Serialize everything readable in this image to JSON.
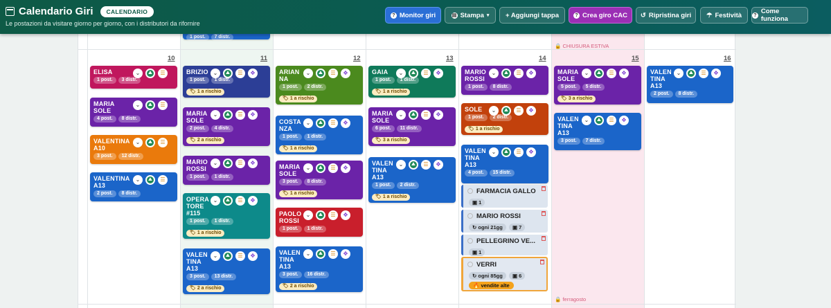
{
  "header": {
    "title": "Calendario Giri",
    "badge": "CALENDARIO",
    "subtitle": "Le postazioni da visitare giorno per giorno, con i distributori da rifornire",
    "buttons": {
      "monitor": "Monitor giri",
      "stampa": "Stampa",
      "aggiungi": "+ Aggiungi tappa",
      "crea_cac": "Crea giro CAC",
      "ripristina": "Ripristina giri",
      "festivita": "Festività",
      "come_funziona": "Come funziona"
    }
  },
  "prev_week": {
    "posts": "1 post.",
    "distr": "7 distr.",
    "closure": "CHIUSURA ESTIVA"
  },
  "days": [
    "10",
    "11",
    "12",
    "13",
    "14",
    "15",
    "16"
  ],
  "ferragosto": "ferragosto",
  "cols": [
    [
      {
        "name": "ELISA",
        "color": "#c0175d",
        "posts": "1 post.",
        "distr": "3 distr.",
        "risk": "",
        "move": false
      },
      {
        "name": "MARIA SOLE",
        "color": "#6b23a8",
        "posts": "4 post.",
        "distr": "8 distr.",
        "risk": "",
        "move": false
      },
      {
        "name": "VALENTINA A10",
        "color": "#ea7a0c",
        "posts": "3 post.",
        "distr": "12 distr.",
        "risk": "",
        "move": false
      },
      {
        "name": "VALENTINA A13",
        "color": "#1b65c9",
        "posts": "2 post.",
        "distr": "8 distr.",
        "risk": "",
        "move": false
      }
    ],
    [
      {
        "name": "BRIZIO",
        "color": "#2c3e96",
        "posts": "1 post.",
        "distr": "1 distr.",
        "risk": "1 a rischio",
        "move": true
      },
      {
        "name": "MARIA SOLE",
        "color": "#6b23a8",
        "posts": "2 post.",
        "distr": "4 distr.",
        "risk": "2 a rischio",
        "move": true
      },
      {
        "name": "MARIO ROSSI",
        "color": "#6b23a8",
        "posts": "1 post.",
        "distr": "1 distr.",
        "risk": "",
        "move": true
      },
      {
        "name": "OPERA TORE #115",
        "color": "#0d8a8a",
        "posts": "1 post.",
        "distr": "1 distr.",
        "risk": "1 a rischio",
        "move": true
      },
      {
        "name": "VALEN TINA A13",
        "color": "#1b65c9",
        "posts": "3 post.",
        "distr": "13 distr.",
        "risk": "2 a rischio",
        "move": true
      }
    ],
    [
      {
        "name": "ARIAN NA",
        "color": "#4b8a1e",
        "posts": "1 post.",
        "distr": "2 distr.",
        "risk": "1 a rischio",
        "move": true
      },
      {
        "name": "COSTA NZA",
        "color": "#1b65c9",
        "posts": "1 post.",
        "distr": "1 distr.",
        "risk": "1 a rischio",
        "move": true
      },
      {
        "name": "MARIA SOLE",
        "color": "#6b23a8",
        "posts": "3 post.",
        "distr": "8 distr.",
        "risk": "1 a rischio",
        "move": true
      },
      {
        "name": "PAOLO ROSSI",
        "color": "#c91f2c",
        "posts": "1 post.",
        "distr": "1 distr.",
        "risk": "",
        "move": true
      },
      {
        "name": "VALEN TINA A13",
        "color": "#1b65c9",
        "posts": "3 post.",
        "distr": "16 distr.",
        "risk": "2 a rischio",
        "move": true
      }
    ],
    [
      {
        "name": "GAIA",
        "color": "#0f7a5a",
        "posts": "1 post.",
        "distr": "1 distr.",
        "risk": "1 a rischio",
        "move": true
      },
      {
        "name": "MARIA SOLE",
        "color": "#6b23a8",
        "posts": "6 post.",
        "distr": "11 distr.",
        "risk": "3 a rischio",
        "move": true
      },
      {
        "name": "VALEN TINA A13",
        "color": "#1b65c9",
        "posts": "1 post.",
        "distr": "2 distr.",
        "risk": "1 a rischio",
        "move": true
      }
    ],
    [
      {
        "name": "MARIO ROSSI",
        "color": "#6b23a8",
        "posts": "1 post.",
        "distr": "8 distr.",
        "risk": "",
        "move": true
      },
      {
        "name": "SOLE",
        "color": "#c2410c",
        "posts": "1 post.",
        "distr": "2 distr.",
        "risk": "1 a rischio",
        "move": true
      },
      {
        "name": "VALEN TINA A13",
        "color": "#1b65c9",
        "posts": "4 post.",
        "distr": "15 distr.",
        "risk": "",
        "move": true
      }
    ],
    [
      {
        "name": "MARIA SOLE",
        "color": "#6b23a8",
        "posts": "5 post.",
        "distr": "5 distr.",
        "risk": "3 a rischio",
        "move": true
      },
      {
        "name": "VALEN TINA A13",
        "color": "#1b65c9",
        "posts": "3 post.",
        "distr": "7 distr.",
        "risk": "",
        "move": true
      }
    ],
    [
      {
        "name": "VALEN TINA A13",
        "color": "#1b65c9",
        "posts": "2 post.",
        "distr": "8 distr.",
        "risk": "",
        "move": true
      }
    ]
  ],
  "stops": [
    {
      "name": "FARMACIA GALLO",
      "count": "1",
      "freq": "",
      "hot": ""
    },
    {
      "name": "MARIO ROSSI",
      "count": "7",
      "freq": "ogni 21gg",
      "hot": ""
    },
    {
      "name": "PELLEGRINO VE...",
      "count": "1",
      "freq": "",
      "hot": ""
    },
    {
      "name": "VERRI",
      "count": "6",
      "freq": "ogni 85gg",
      "hot": "vendite alte"
    }
  ],
  "colors": {
    "header": "#0e5a46",
    "accent_blue": "#2a6fd6",
    "accent_purple": "#9b2fb5",
    "closure": "#fbe7ee"
  }
}
